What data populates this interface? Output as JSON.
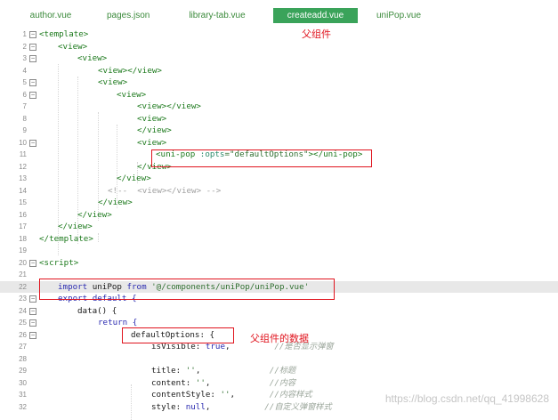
{
  "tabs": [
    {
      "label": "author.vue",
      "active": false
    },
    {
      "label": "pages.json",
      "active": false
    },
    {
      "label": "library-tab.vue",
      "active": false
    },
    {
      "label": "createadd.vue",
      "active": true
    },
    {
      "label": "uniPop.vue",
      "active": false
    }
  ],
  "annotations": {
    "parent_component": "父组件",
    "parent_component_data": "父组件的数据"
  },
  "lines": [
    {
      "n": "1",
      "parts": [
        {
          "t": "<template>",
          "c": "tag"
        }
      ]
    },
    {
      "n": "2",
      "parts": [
        {
          "t": "<view>",
          "c": "tag"
        }
      ]
    },
    {
      "n": "3",
      "parts": [
        {
          "t": "<view>",
          "c": "tag"
        }
      ]
    },
    {
      "n": "4",
      "parts": [
        {
          "t": "<view></view>",
          "c": "tag"
        }
      ]
    },
    {
      "n": "5",
      "parts": [
        {
          "t": "<view>",
          "c": "tag"
        }
      ]
    },
    {
      "n": "6",
      "parts": [
        {
          "t": "<view>",
          "c": "tag"
        }
      ]
    },
    {
      "n": "7",
      "parts": [
        {
          "t": "<view></view>",
          "c": "tag"
        }
      ]
    },
    {
      "n": "8",
      "parts": [
        {
          "t": "<view>",
          "c": "tag"
        }
      ]
    },
    {
      "n": "9",
      "parts": [
        {
          "t": "</view>",
          "c": "tag"
        }
      ]
    },
    {
      "n": "10",
      "parts": [
        {
          "t": "<view>",
          "c": "tag"
        }
      ]
    },
    {
      "n": "11",
      "parts": [
        {
          "t": "<uni-pop ",
          "c": "tag"
        },
        {
          "t": ":opts",
          "c": "attr"
        },
        {
          "t": "=\"defaultOptions\"",
          "c": "str"
        },
        {
          "t": "></uni-pop>",
          "c": "tag"
        }
      ]
    },
    {
      "n": "12",
      "parts": [
        {
          "t": "</view>",
          "c": "tag"
        }
      ]
    },
    {
      "n": "13",
      "parts": [
        {
          "t": "</view>",
          "c": "tag"
        }
      ]
    },
    {
      "n": "14",
      "parts": [
        {
          "t": "<!-- ",
          "c": "cmtlead"
        },
        {
          "t": " <view></view> -->",
          "c": "cmtlead"
        }
      ]
    },
    {
      "n": "15",
      "parts": [
        {
          "t": "</view>",
          "c": "tag"
        }
      ]
    },
    {
      "n": "16",
      "parts": [
        {
          "t": "</view>",
          "c": "tag"
        }
      ]
    },
    {
      "n": "17",
      "parts": [
        {
          "t": "</view>",
          "c": "tag"
        }
      ]
    },
    {
      "n": "18",
      "parts": [
        {
          "t": "</template>",
          "c": "tag"
        }
      ]
    },
    {
      "n": "19",
      "parts": []
    },
    {
      "n": "20",
      "parts": [
        {
          "t": "<script>",
          "c": "tag"
        }
      ]
    },
    {
      "n": "21",
      "parts": []
    },
    {
      "n": "22",
      "parts": [
        {
          "t": "import ",
          "c": "kw"
        },
        {
          "t": "uniPop ",
          "c": "plain"
        },
        {
          "t": "from ",
          "c": "kw"
        },
        {
          "t": "'@/components/uniPop/uniPop.vue'",
          "c": "str"
        }
      ]
    },
    {
      "n": "23",
      "parts": [
        {
          "t": "export default {",
          "c": "kw"
        }
      ]
    },
    {
      "n": "24",
      "parts": [
        {
          "t": "data() {",
          "c": "plain"
        }
      ]
    },
    {
      "n": "25",
      "parts": [
        {
          "t": "return {",
          "c": "kw"
        }
      ]
    },
    {
      "n": "26",
      "parts": [
        {
          "t": "defaultOptions: {",
          "c": "plain"
        }
      ]
    },
    {
      "n": "27",
      "parts": [
        {
          "t": "isVisible: ",
          "c": "plain"
        },
        {
          "t": "true",
          "c": "kw"
        },
        {
          "t": ",         ",
          "c": "plain"
        },
        {
          "t": "//是否显示弹窗",
          "c": "cmt"
        }
      ]
    },
    {
      "n": "28",
      "parts": []
    },
    {
      "n": "29",
      "parts": [
        {
          "t": "title: ",
          "c": "plain"
        },
        {
          "t": "''",
          "c": "str"
        },
        {
          "t": ",              ",
          "c": "plain"
        },
        {
          "t": "//标题",
          "c": "cmt"
        }
      ]
    },
    {
      "n": "30",
      "parts": [
        {
          "t": "content: ",
          "c": "plain"
        },
        {
          "t": "''",
          "c": "str"
        },
        {
          "t": ",            ",
          "c": "plain"
        },
        {
          "t": "//内容",
          "c": "cmt"
        }
      ]
    },
    {
      "n": "31",
      "parts": [
        {
          "t": "contentStyle: ",
          "c": "plain"
        },
        {
          "t": "''",
          "c": "str"
        },
        {
          "t": ",       ",
          "c": "plain"
        },
        {
          "t": "//内容样式",
          "c": "cmt"
        }
      ]
    },
    {
      "n": "32",
      "parts": [
        {
          "t": "style: ",
          "c": "plain"
        },
        {
          "t": "null",
          "c": "kw"
        },
        {
          "t": ",           ",
          "c": "plain"
        },
        {
          "t": "//自定义弹窗样式",
          "c": "cmt"
        }
      ]
    }
  ],
  "watermark": "https://blog.csdn.net/qq_41998628"
}
